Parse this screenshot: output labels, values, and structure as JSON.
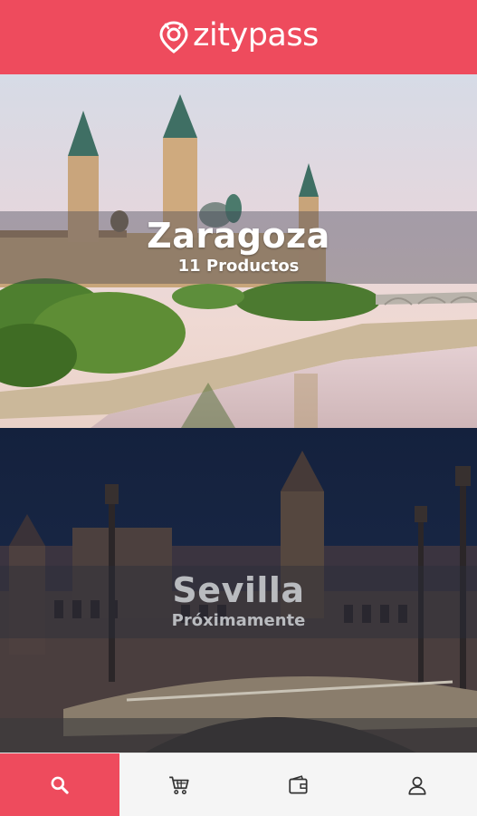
{
  "app": {
    "brand": "zitypass",
    "brand_color": "#ee4b5d"
  },
  "cities": [
    {
      "name": "Zaragoza",
      "subtitle": "11 Productos",
      "available": true
    },
    {
      "name": "Sevilla",
      "subtitle": "Próximamente",
      "available": false
    }
  ],
  "bottom_nav": {
    "items": [
      {
        "icon": "search-icon",
        "active": true
      },
      {
        "icon": "cart-icon",
        "active": false
      },
      {
        "icon": "wallet-icon",
        "active": false
      },
      {
        "icon": "user-icon",
        "active": false
      }
    ]
  }
}
